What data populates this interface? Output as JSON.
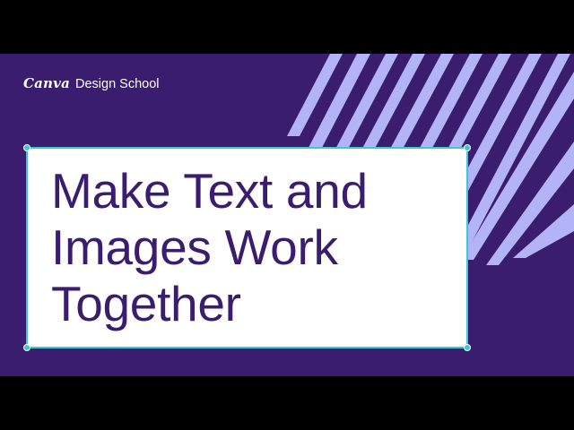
{
  "brand": {
    "logo": "Canva",
    "name": "Design School"
  },
  "headline": {
    "lines": [
      "Make Text and",
      "Images Work",
      "Together"
    ]
  },
  "colors": {
    "background": "#3a1d6e",
    "stripes": "#b3b3f7",
    "headline": "#3a1d6e",
    "selection": "#3fc4d8",
    "letterbox": "#000000"
  },
  "icons": {
    "decoration": "diagonal-stripes"
  }
}
